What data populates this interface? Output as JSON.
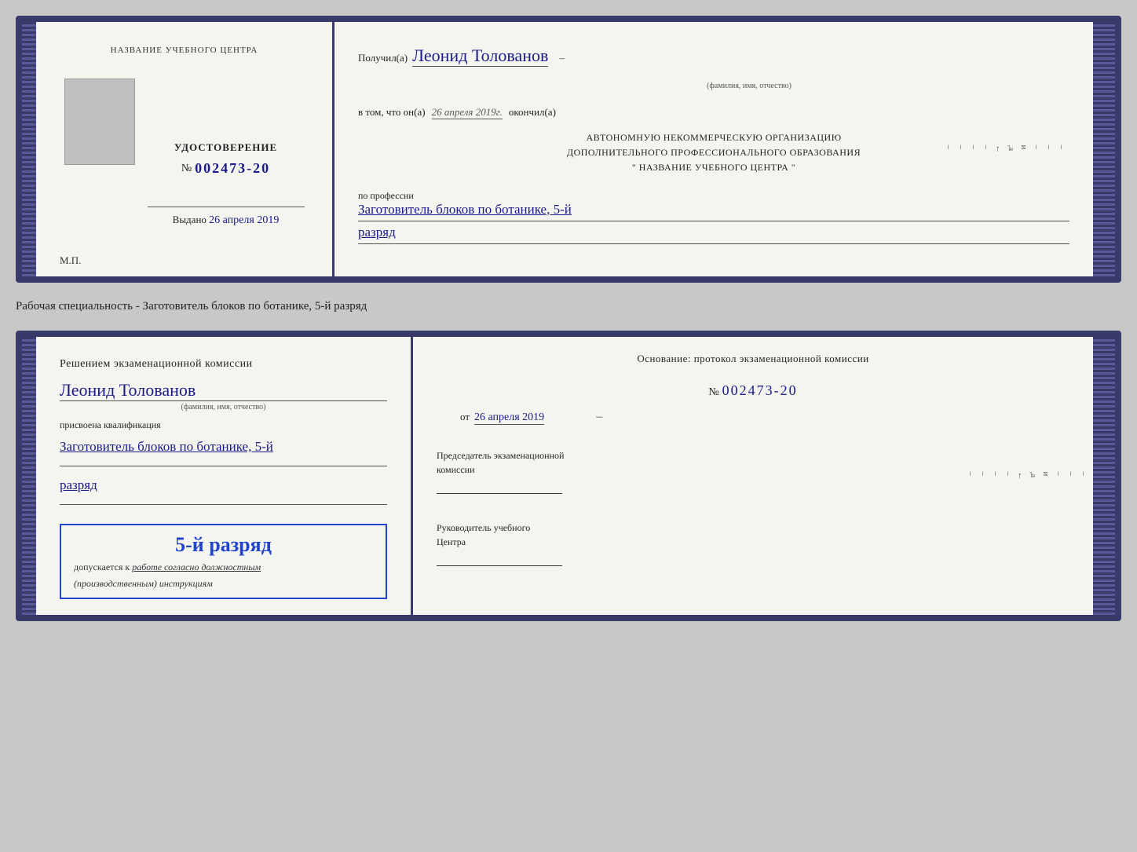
{
  "doc1": {
    "left": {
      "institution_label": "НАЗВАНИЕ УЧЕБНОГО ЦЕНТРА",
      "cert_title": "УДОСТОВЕРЕНИЕ",
      "cert_number_prefix": "№",
      "cert_number": "002473-20",
      "issued_label": "Выдано",
      "issued_date": "26 апреля 2019",
      "mp_label": "М.П."
    },
    "right": {
      "received_prefix": "Получил(а)",
      "full_name": "Леонид Толованов",
      "fio_subtitle": "(фамилия, имя, отчество)",
      "date_prefix": "в том, что он(а)",
      "date_value": "26 апреля 2019г.",
      "finished": "окончил(а)",
      "org_line1": "АВТОНОМНУЮ НЕКОММЕРЧЕСКУЮ ОРГАНИЗАЦИЮ",
      "org_line2": "ДОПОЛНИТЕЛЬНОГО ПРОФЕССИОНАЛЬНОГО ОБРАЗОВАНИЯ",
      "org_line3": "\"   НАЗВАНИЕ УЧЕБНОГО ЦЕНТРА   \"",
      "profession_prefix": "по профессии",
      "profession_value": "Заготовитель блоков по ботанике, 5-й",
      "rank_value": "разряд",
      "edge_chars": [
        "–",
        "–",
        "–",
        "и",
        ",а",
        "←",
        "–",
        "–",
        "–",
        "–"
      ]
    }
  },
  "specialty_label": "Рабочая специальность - Заготовитель блоков по ботанике, 5-й разряд",
  "doc2": {
    "left": {
      "commission_prefix": "Решением экзаменационной комиссии",
      "full_name": "Леонид Толованов",
      "fio_subtitle": "(фамилия, имя, отчество)",
      "qualified_label": "присвоена квалификация",
      "profession_value": "Заготовитель блоков по ботанике, 5-й",
      "rank_value": "разряд",
      "rank_box_title": "5-й разряд",
      "rank_box_sub": "допускается к",
      "rank_box_link": "работе согласно должностным",
      "rank_box_italic": "(производственным) инструкциям"
    },
    "right": {
      "basis_label": "Основание: протокол экзаменационной комиссии",
      "protocol_prefix": "№",
      "protocol_number": "002473-20",
      "from_prefix": "от",
      "from_date": "26 апреля 2019",
      "chairman_label": "Председатель экзаменационной",
      "chairman_label2": "комиссии",
      "director_label": "Руководитель учебного",
      "director_label2": "Центра",
      "edge_chars": [
        "–",
        "–",
        "–",
        "и",
        ",а",
        "←",
        "–",
        "–",
        "–",
        "–"
      ]
    }
  }
}
